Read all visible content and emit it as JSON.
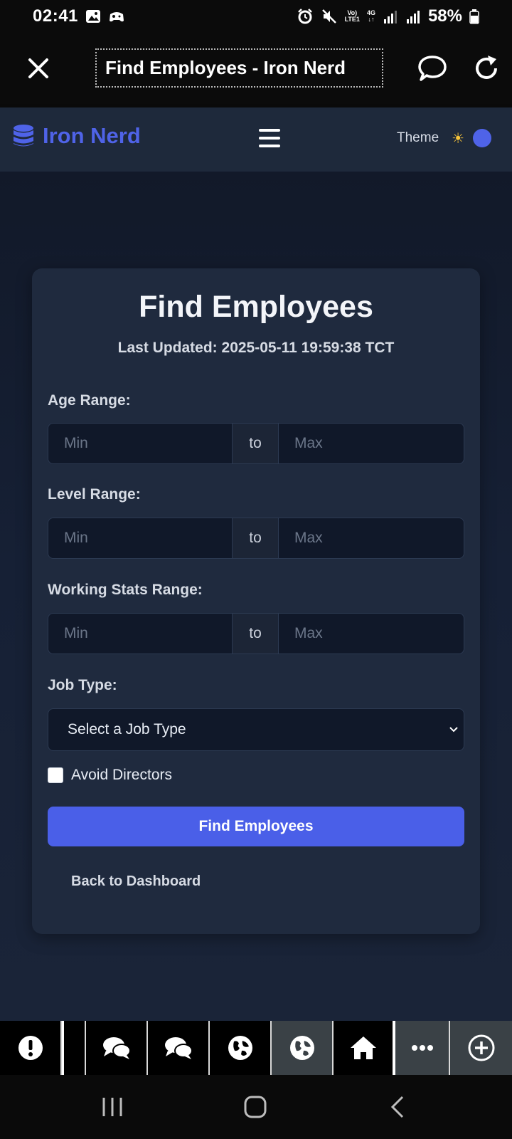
{
  "status_bar": {
    "time": "02:41",
    "battery": "58%",
    "network_top": "Vo)",
    "network_bottom": "LTE1",
    "network_type": "4G"
  },
  "browser": {
    "title": "Find Employees - Iron Nerd"
  },
  "navbar": {
    "brand": "Iron Nerd",
    "theme_label": "Theme",
    "theme_icon": "☀"
  },
  "card": {
    "title": "Find Employees",
    "last_updated": "Last Updated: 2025-05-11 19:59:38 TCT",
    "age_label": "Age Range:",
    "level_label": "Level Range:",
    "working_label": "Working Stats Range:",
    "min_placeholder": "Min",
    "max_placeholder": "Max",
    "to_label": "to",
    "job_type_label": "Job Type:",
    "job_type_selected": "Select a Job Type",
    "avoid_directors_label": "Avoid Directors",
    "find_button": "Find Employees",
    "back_link": "Back to Dashboard"
  },
  "app_bar": {
    "items": [
      "alert-icon",
      "chat-icon",
      "chat-icon",
      "globe-icon",
      "globe-icon",
      "home-icon",
      "more-icon",
      "add-icon"
    ]
  },
  "colors": {
    "accent": "#4a5fe8",
    "card_bg": "#1f2a3e",
    "input_bg": "#101829",
    "navbar_bg": "#1e293b"
  }
}
